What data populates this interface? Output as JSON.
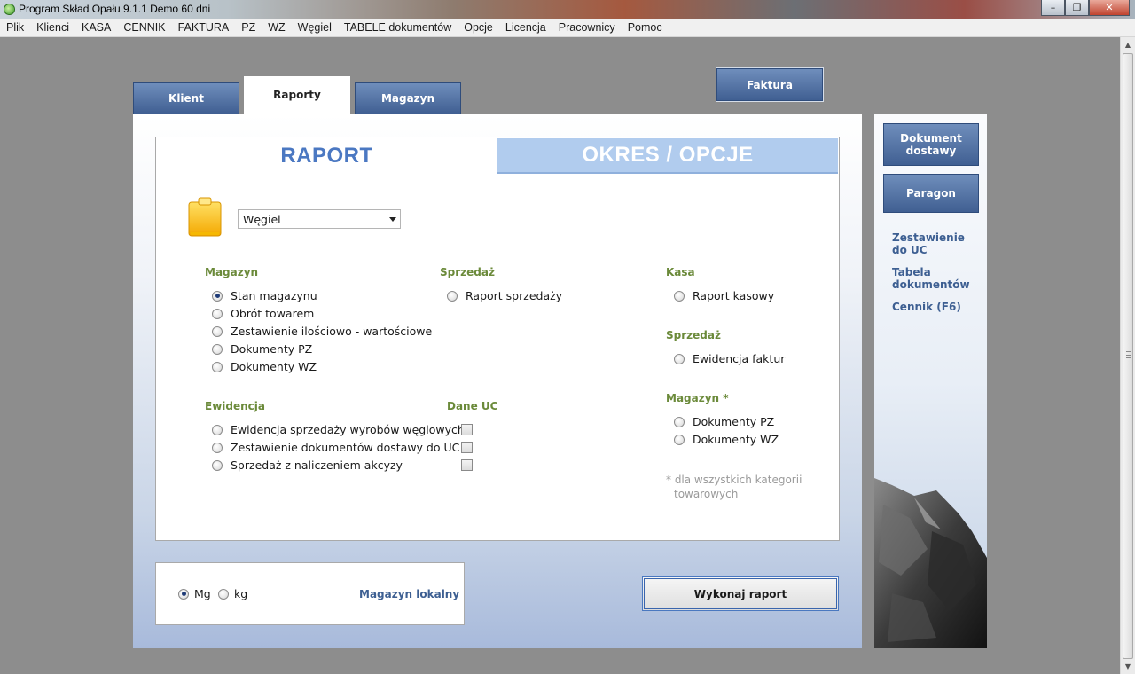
{
  "window": {
    "title": "Program Skład Opału 9.1.1   Demo 60 dni",
    "minimize": "–",
    "maximize": "❐",
    "close": "✕"
  },
  "menu": [
    "Plik",
    "Klienci",
    "KASA",
    "CENNIK",
    "FAKTURA",
    "PZ",
    "WZ",
    "Węgiel",
    "TABELE dokumentów",
    "Opcje",
    "Licencja",
    "Pracownicy",
    "Pomoc"
  ],
  "tabs": {
    "klient": "Klient",
    "raporty": "Raporty",
    "magazyn": "Magazyn",
    "active": "Raporty"
  },
  "faktura_button": "Faktura",
  "headers": {
    "raport": "RAPORT",
    "okres": "OKRES / OPCJE"
  },
  "category_select": {
    "value": "Węgiel"
  },
  "sections": {
    "magazyn": {
      "title": "Magazyn",
      "options": [
        "Stan magazynu",
        "Obrót towarem",
        "Zestawienie ilościowo - wartościowe",
        "Dokumenty PZ",
        "Dokumenty WZ"
      ],
      "selected": "Stan magazynu"
    },
    "sprzedaz": {
      "title": "Sprzedaż",
      "options": [
        "Raport sprzedaży"
      ]
    },
    "kasa": {
      "title": "Kasa",
      "options": [
        "Raport kasowy"
      ]
    },
    "sprzedaz2": {
      "title": "Sprzedaż",
      "options": [
        "Ewidencja faktur"
      ]
    },
    "magazyn_all": {
      "title": "Magazyn *",
      "options": [
        "Dokumenty PZ",
        "Dokumenty WZ"
      ]
    },
    "ewidencja": {
      "title": "Ewidencja",
      "options": [
        "Ewidencja sprzedaży wyrobów węglowych",
        "Zestawienie dokumentów dostawy do UC",
        "Sprzedaż z naliczeniem akcyzy"
      ]
    },
    "dane_uc": {
      "title": "Dane UC",
      "checked": [
        false,
        false,
        false
      ]
    }
  },
  "note": {
    "line1": "* dla wszystkich kategorii",
    "line2": "towarowych"
  },
  "units": {
    "mg": "Mg",
    "kg": "kg",
    "selected": "Mg"
  },
  "magazyn_lokalny": "Magazyn lokalny",
  "execute_button": "Wykonaj raport",
  "right_panel": {
    "dokument_dostawy_1": "Dokument",
    "dokument_dostawy_2": "dostawy",
    "paragon": "Paragon",
    "links": {
      "zestawienie_1": "Zestawienie",
      "zestawienie_2": "do UC",
      "tabela_1": "Tabela",
      "tabela_2": "dokumentów",
      "cennik": "Cennik (F6)"
    }
  },
  "icons": {
    "app": "app-globe-icon",
    "clipboard": "clipboard-icon",
    "dropdown": "chevron-down-icon"
  },
  "colors": {
    "accent_blue": "#4b78c2",
    "button_blue": "#405f92",
    "section_green": "#6b8a3a",
    "link_blue": "#3d5f92"
  }
}
